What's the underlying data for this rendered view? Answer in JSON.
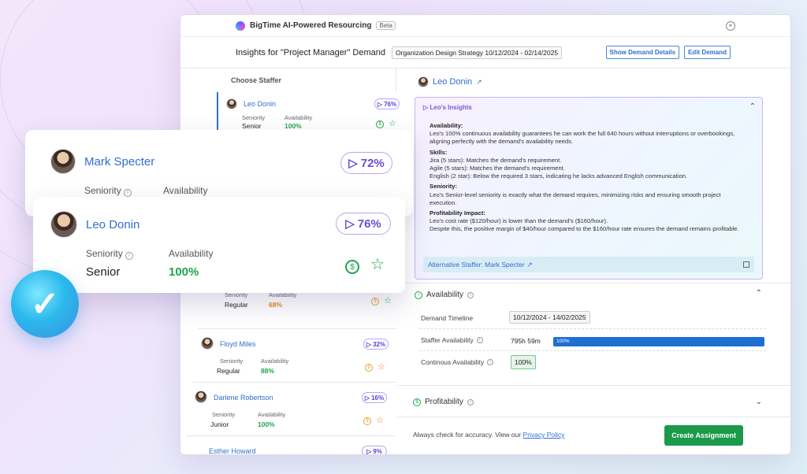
{
  "app": {
    "title": "BigTime AI-Powered Resourcing",
    "badge": "Beta"
  },
  "header": {
    "title": "Insights for \"Project Manager\" Demand",
    "demand": "Organization Design Strategy 10/12/2024 - 02/14/2025",
    "show_details": "Show Demand Details",
    "edit_demand": "Edit Demand"
  },
  "sidebar": {
    "heading": "Choose Staffer",
    "labels": {
      "seniority": "Seniority",
      "availability": "Availability"
    },
    "items": [
      {
        "name": "Leo Donin",
        "pct": "76%",
        "seniority": "Senior",
        "availability": "100%"
      },
      {
        "name": "",
        "pct": "",
        "seniority": "Regular",
        "availability": "68%"
      },
      {
        "name": "Floyd Miles",
        "pct": "32%",
        "seniority": "Regular",
        "availability": "88%"
      },
      {
        "name": "Darlene Robertson",
        "pct": "16%",
        "seniority": "Junior",
        "availability": "100%"
      },
      {
        "name": "Esther Howard",
        "pct": "9%"
      }
    ]
  },
  "detail": {
    "name": "Leo Donin",
    "insights_title": "Leo's Insights",
    "availability_h": "Availability:",
    "availability_t": "Leo's 100% continuous availability guarantees he can work the full 640 hours without interruptions or overbookings, aligning perfectly with the demand's availability needs.",
    "skills_h": "Skills:",
    "skill1": "Jira (5 stars): Matches the demand's requirement.",
    "skill2": "Agile (5 stars): Matches the demand's requirement.",
    "skill3": "English (2 star): Below the required 3 stars, indicating he lacks advanced English communication.",
    "seniority_h": "Seniority:",
    "seniority_t": "Leo's Senior-level seniority is exactly what the demand requires, minimizing risks and ensuring smooth project execution.",
    "profit_h": "Profitability Impact:",
    "profit_t1": "Leo's cost rate ($120/hour) is lower than the demand's ($160/hour).",
    "profit_t2": "Despite this, the positive margin of $40/hour compared to the $160/hour rate ensures the demand remains profitable.",
    "alt": "Alternative Staffer: Mark Specter"
  },
  "availability": {
    "title": "Availability",
    "timeline_label": "Demand Timeline",
    "timeline": "10/12/2024 - 14/02/2025",
    "staffer_label": "Staffer Availability",
    "hours": "795h 59m",
    "bar": "100%",
    "bar_fraction": 1.0,
    "continuous_label": "Continous Availability",
    "continuous": "100%"
  },
  "profitability": {
    "title": "Profitability"
  },
  "footer": {
    "note": "Always check for accuracy. View our",
    "link": "Privacy Policy",
    "create": "Create Assignment"
  },
  "floating": {
    "mark": {
      "name": "Mark Specter",
      "pct": "72%",
      "seniority_label": "Seniority",
      "availability_label": "Availability"
    },
    "leo": {
      "name": "Leo Donin",
      "pct": "76%",
      "seniority_label": "Seniority",
      "availability_label": "Availability",
      "seniority": "Senior",
      "availability": "100%"
    }
  },
  "colors": {
    "accent": "#2f6fd0",
    "green": "#1a9a4a",
    "purple": "#7a55d8"
  }
}
